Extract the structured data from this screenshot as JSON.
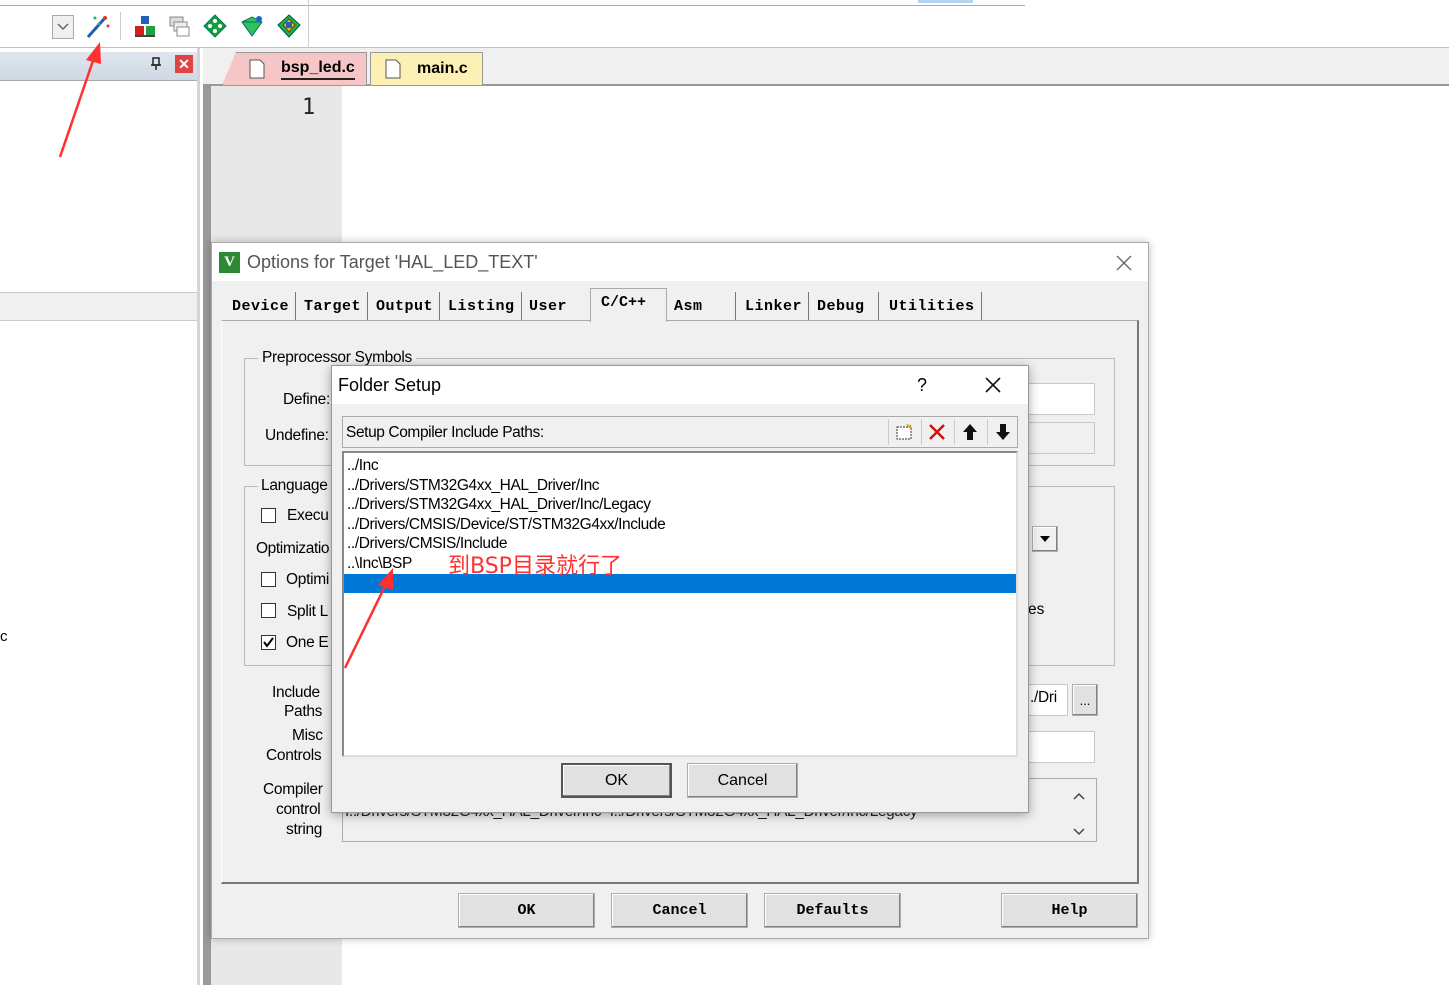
{
  "editor": {
    "tabs": [
      {
        "label": "bsp_led.c"
      },
      {
        "label": "main.c"
      }
    ],
    "line_number": "1"
  },
  "left_panel": {
    "pin": "ᵽ",
    "partial_text": "c"
  },
  "options_dialog": {
    "title": "Options for Target 'HAL_LED_TEXT'",
    "tabs": [
      "Device",
      "Target",
      "Output",
      "Listing",
      "User",
      "C/C++",
      "Asm",
      "Linker",
      "Debug",
      "Utilities"
    ],
    "active_tab": "C/C++",
    "preprocessor_group": "Preprocessor Symbols",
    "define_label": "Define:",
    "undefine_label": "Undefine:",
    "language_group": "Language",
    "execu_label": "Execu",
    "optimization_label": "Optimizatio",
    "optimi_label": "Optimi",
    "split_label": "Split L",
    "one_label": "One E",
    "one_checked": true,
    "partial_es": "es",
    "include_paths_label_1": "Include",
    "include_paths_label_2": "Paths",
    "include_paths_value": "../Dri",
    "browse_label": "...",
    "misc_label_1": "Misc",
    "misc_label_2": "Controls",
    "compiler_label_1": "Compiler",
    "compiler_label_2": "control",
    "compiler_label_3": "string",
    "compiler_string": "I../Drivers/STM32G4xx_HAL_Driver/Inc -I../Drivers/STM32G4xx_HAL_Driver/Inc/Legacy",
    "buttons": {
      "ok": "OK",
      "cancel": "Cancel",
      "defaults": "Defaults",
      "help": "Help"
    }
  },
  "folder_setup": {
    "title": "Folder Setup",
    "help": "?",
    "header_label": "Setup Compiler Include Paths:",
    "paths": [
      "../Inc",
      "../Drivers/STM32G4xx_HAL_Driver/Inc",
      "../Drivers/STM32G4xx_HAL_Driver/Inc/Legacy",
      "../Drivers/CMSIS/Device/ST/STM32G4xx/Include",
      "../Drivers/CMSIS/Include",
      "..\\Inc\\BSP"
    ],
    "annotation": "到BSP目录就行了",
    "buttons": {
      "ok": "OK",
      "cancel": "Cancel"
    }
  },
  "colors": {
    "selection": "#0078d7",
    "annotation": "#ff3030",
    "tab_active": "#f6c6c6",
    "tab_inactive": "#fdf0b4",
    "close_red": "#e04343"
  }
}
